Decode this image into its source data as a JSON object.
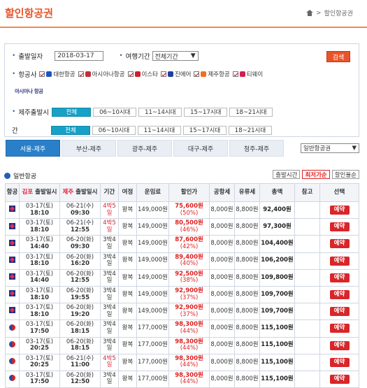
{
  "header": {
    "title": "할인항공권",
    "breadcrumb": "할인항공권"
  },
  "search": {
    "dep_label": "출발일자",
    "dep_value": "2018-03-17",
    "period_label": "여행기간",
    "period_value": "전체기간",
    "search_button": "검색",
    "airline_label": "항공사",
    "airlines": [
      {
        "name": "대한항공",
        "color": "#1b56c4"
      },
      {
        "name": "아시아나항공",
        "color": "#c0303a"
      },
      {
        "name": "이스타",
        "color": "#d0202a"
      },
      {
        "name": "진에어",
        "color": "#2040a0"
      },
      {
        "name": "제주항공",
        "color": "#f07020"
      },
      {
        "name": "티웨이",
        "color": "#d02050"
      }
    ],
    "extra_logo": "아시아나 항공",
    "jeju_dep_label": "제주출발시",
    "jeju_dep_label2": "간",
    "time_options": [
      "전체",
      "06~10시대",
      "11~14시대",
      "15~17시대",
      "18~21시대"
    ],
    "time_options2": [
      "전체",
      "06~10시대",
      "11~14시대",
      "15~17시대",
      "18~21시대"
    ]
  },
  "tabs": {
    "items": [
      "서울-제주",
      "부산-제주",
      "광주-제주",
      "대구-제주",
      "청주-제주"
    ],
    "select": "일반항공권"
  },
  "grid": {
    "title": "일반항공",
    "sort_buttons": [
      "출발시간",
      "최저가순",
      "할인율순"
    ],
    "columns": [
      "항공",
      "김포 출발일시",
      "제주 출발일시",
      "기간",
      "여정",
      "운임료",
      "할인가",
      "공항세",
      "유류세",
      "총액",
      "참고",
      "선택"
    ],
    "reserve_label": "예약",
    "rows": [
      {
        "al": "ks",
        "d1": "03-17(토)",
        "t1": "18:10",
        "d2": "06-21(수)",
        "t2": "09:30",
        "period": "4박5일",
        "trip": "왕복",
        "fare": "149,000원",
        "disc": "75,600원",
        "rate": "(50%)",
        "tax": "8,000원",
        "fuel": "8,800원",
        "total": "92,400원"
      },
      {
        "al": "ks",
        "d1": "03-17(토)",
        "t1": "18:10",
        "d2": "06-21(수)",
        "t2": "12:55",
        "period": "4박5일",
        "trip": "왕복",
        "fare": "149,000원",
        "disc": "80,500원",
        "rate": "(46%)",
        "tax": "8,000원",
        "fuel": "8,800원",
        "total": "97,300원"
      },
      {
        "al": "ks",
        "d1": "03-17(토)",
        "t1": "14:40",
        "d2": "06-20(화)",
        "t2": "09:30",
        "period": "3박4일",
        "trip": "왕복",
        "fare": "149,000원",
        "disc": "87,600원",
        "rate": "(42%)",
        "tax": "8,000원",
        "fuel": "8,800원",
        "total": "104,400원"
      },
      {
        "al": "ks",
        "d1": "03-17(토)",
        "t1": "18:10",
        "d2": "06-20(화)",
        "t2": "16:20",
        "period": "3박4일",
        "trip": "왕복",
        "fare": "149,000원",
        "disc": "89,400원",
        "rate": "(40%)",
        "tax": "8,000원",
        "fuel": "8,800원",
        "total": "106,200원"
      },
      {
        "al": "ks",
        "d1": "03-17(토)",
        "t1": "14:40",
        "d2": "06-20(화)",
        "t2": "12:55",
        "period": "3박4일",
        "trip": "왕복",
        "fare": "149,000원",
        "disc": "92,500원",
        "rate": "(38%)",
        "tax": "8,000원",
        "fuel": "8,800원",
        "total": "109,800원"
      },
      {
        "al": "ks",
        "d1": "03-17(토)",
        "t1": "18:10",
        "d2": "06-20(화)",
        "t2": "19:55",
        "period": "3박4일",
        "trip": "왕복",
        "fare": "149,000원",
        "disc": "92,900원",
        "rate": "(37%)",
        "tax": "8,000원",
        "fuel": "8,800원",
        "total": "109,700원"
      },
      {
        "al": "ks",
        "d1": "03-17(토)",
        "t1": "18:10",
        "d2": "06-20(화)",
        "t2": "19:20",
        "period": "3박4일",
        "trip": "왕복",
        "fare": "149,000원",
        "disc": "92,900원",
        "rate": "(37%)",
        "tax": "8,000원",
        "fuel": "8,800원",
        "total": "109,700원"
      },
      {
        "al": "ke",
        "d1": "03-17(토)",
        "t1": "17:50",
        "d2": "06-20(화)",
        "t2": "18:15",
        "period": "3박4일",
        "trip": "왕복",
        "fare": "177,000원",
        "disc": "98,300원",
        "rate": "(44%)",
        "tax": "8,000원",
        "fuel": "8,800원",
        "total": "115,100원"
      },
      {
        "al": "ke",
        "d1": "03-17(토)",
        "t1": "20:25",
        "d2": "06-20(화)",
        "t2": "18:15",
        "period": "3박4일",
        "trip": "왕복",
        "fare": "177,000원",
        "disc": "98,300원",
        "rate": "(44%)",
        "tax": "8,000원",
        "fuel": "8,800원",
        "total": "115,100원"
      },
      {
        "al": "ke",
        "d1": "03-17(토)",
        "t1": "20:25",
        "d2": "06-21(수)",
        "t2": "11:00",
        "period": "4박5일",
        "trip": "왕복",
        "fare": "177,000원",
        "disc": "98,300원",
        "rate": "(44%)",
        "tax": "8,000원",
        "fuel": "8,800원",
        "total": "115,100원"
      },
      {
        "al": "ke",
        "d1": "03-17(토)",
        "t1": "17:50",
        "d2": "06-20(화)",
        "t2": "12:50",
        "period": "3박4일",
        "trip": "왕복",
        "fare": "177,000원",
        "disc": "98,300원",
        "rate": "(44%)",
        "tax": "8,000원",
        "fuel": "8,800원",
        "total": "115,100원"
      }
    ]
  }
}
